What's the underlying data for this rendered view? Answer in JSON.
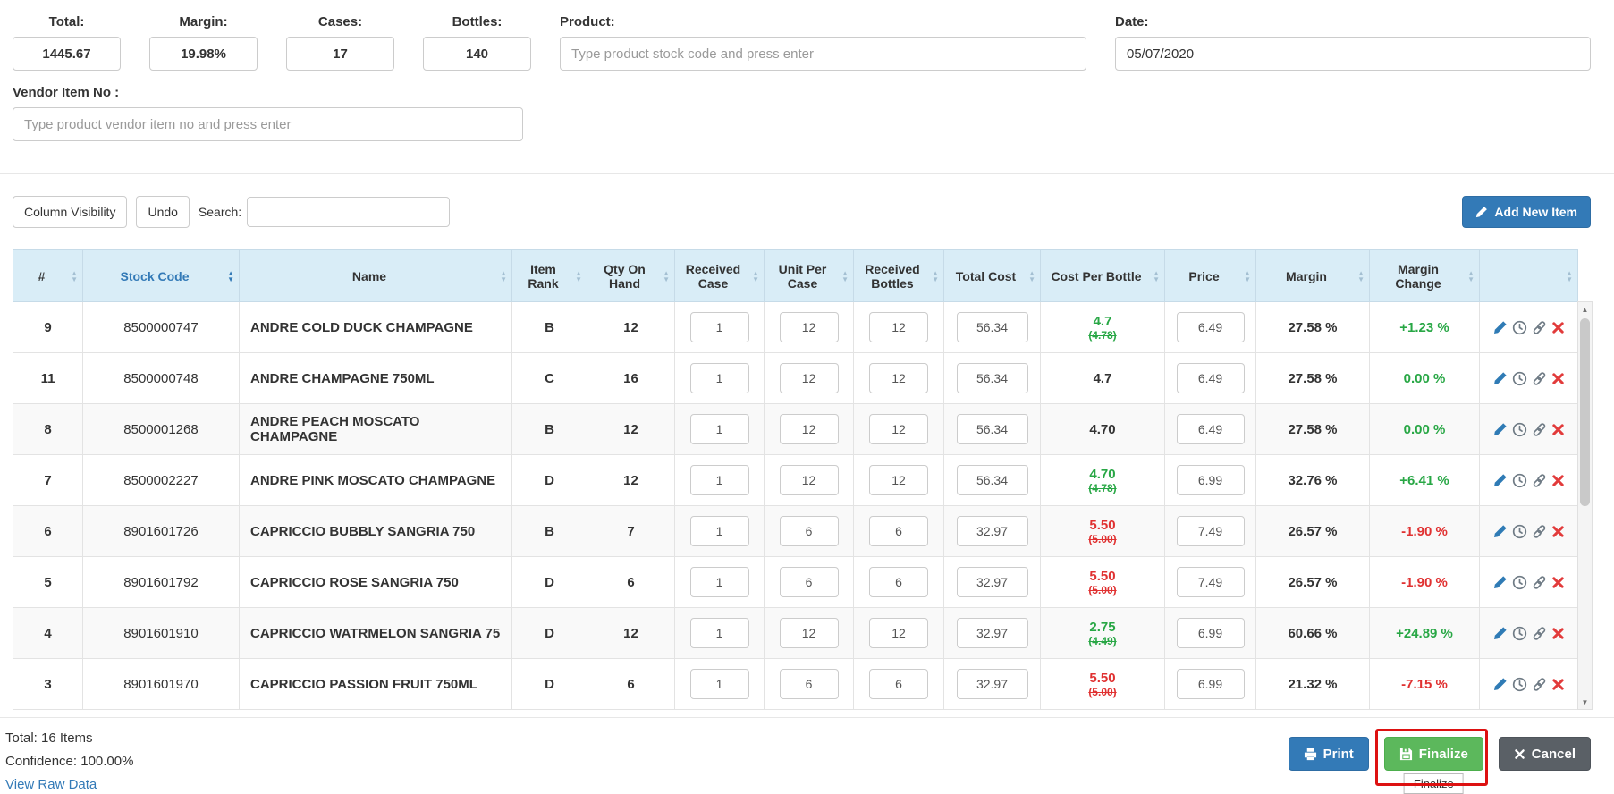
{
  "header": {
    "stats": [
      {
        "label": "Total:",
        "value": "1445.67"
      },
      {
        "label": "Margin:",
        "value": "19.98%"
      },
      {
        "label": "Cases:",
        "value": "17"
      },
      {
        "label": "Bottles:",
        "value": "140"
      }
    ],
    "product_label": "Product:",
    "product_placeholder": "Type product stock code and press enter",
    "date_label": "Date:",
    "date_value": "05/07/2020",
    "vendor_label": "Vendor Item No :",
    "vendor_placeholder": "Type product vendor item no and press enter"
  },
  "toolbar": {
    "column_visibility": "Column Visibility",
    "undo": "Undo",
    "search_label": "Search:",
    "search_value": "",
    "add_new_item": "Add New Item"
  },
  "table": {
    "columns": [
      "#",
      "Stock Code",
      "Name",
      "Item Rank",
      "Qty On Hand",
      "Received Case",
      "Unit Per Case",
      "Received Bottles",
      "Total Cost",
      "Cost Per Bottle",
      "Price",
      "Margin",
      "Margin Change",
      ""
    ],
    "sorted_column": "Stock Code",
    "rows": [
      {
        "num": "9",
        "stock": "8500000747",
        "name": "ANDRE COLD DUCK CHAMPAGNE",
        "rank": "B",
        "qty": "12",
        "received_case": "1",
        "unit_per_case": "12",
        "received_bottles": "12",
        "total_cost": "56.34",
        "cost_per_bottle": "4.7",
        "cost_old": "(4.78)",
        "cost_color": "green",
        "price": "6.49",
        "margin": "27.58 %",
        "margin_change": "+1.23 %",
        "change_color": "green"
      },
      {
        "num": "11",
        "stock": "8500000748",
        "name": "ANDRE CHAMPAGNE 750ML",
        "rank": "C",
        "qty": "16",
        "received_case": "1",
        "unit_per_case": "12",
        "received_bottles": "12",
        "total_cost": "56.34",
        "cost_per_bottle": "4.7",
        "cost_old": "",
        "cost_color": "dark",
        "price": "6.49",
        "margin": "27.58 %",
        "margin_change": "0.00 %",
        "change_color": "green"
      },
      {
        "num": "8",
        "stock": "8500001268",
        "name": "ANDRE PEACH MOSCATO\nCHAMPAGNE",
        "rank": "B",
        "qty": "12",
        "received_case": "1",
        "unit_per_case": "12",
        "received_bottles": "12",
        "total_cost": "56.34",
        "cost_per_bottle": "4.70",
        "cost_old": "",
        "cost_color": "dark",
        "price": "6.49",
        "margin": "27.58 %",
        "margin_change": "0.00 %",
        "change_color": "green"
      },
      {
        "num": "7",
        "stock": "8500002227",
        "name": "ANDRE PINK MOSCATO CHAMPAGNE",
        "rank": "D",
        "qty": "12",
        "received_case": "1",
        "unit_per_case": "12",
        "received_bottles": "12",
        "total_cost": "56.34",
        "cost_per_bottle": "4.70",
        "cost_old": "(4.78)",
        "cost_color": "green",
        "price": "6.99",
        "margin": "32.76 %",
        "margin_change": "+6.41 %",
        "change_color": "green"
      },
      {
        "num": "6",
        "stock": "8901601726",
        "name": "CAPRICCIO BUBBLY SANGRIA 750",
        "rank": "B",
        "qty": "7",
        "received_case": "1",
        "unit_per_case": "6",
        "received_bottles": "6",
        "total_cost": "32.97",
        "cost_per_bottle": "5.50",
        "cost_old": "(5.00)",
        "cost_color": "red",
        "price": "7.49",
        "margin": "26.57 %",
        "margin_change": "-1.90 %",
        "change_color": "red"
      },
      {
        "num": "5",
        "stock": "8901601792",
        "name": "CAPRICCIO ROSE SANGRIA 750",
        "rank": "D",
        "qty": "6",
        "received_case": "1",
        "unit_per_case": "6",
        "received_bottles": "6",
        "total_cost": "32.97",
        "cost_per_bottle": "5.50",
        "cost_old": "(5.00)",
        "cost_color": "red",
        "price": "7.49",
        "margin": "26.57 %",
        "margin_change": "-1.90 %",
        "change_color": "red"
      },
      {
        "num": "4",
        "stock": "8901601910",
        "name": "CAPRICCIO WATRMELON SANGRIA 75",
        "rank": "D",
        "qty": "12",
        "received_case": "1",
        "unit_per_case": "12",
        "received_bottles": "12",
        "total_cost": "32.97",
        "cost_per_bottle": "2.75",
        "cost_old": "(4.49)",
        "cost_color": "green",
        "price": "6.99",
        "margin": "60.66 %",
        "margin_change": "+24.89 %",
        "change_color": "green"
      },
      {
        "num": "3",
        "stock": "8901601970",
        "name": "CAPRICCIO PASSION FRUIT 750ML",
        "rank": "D",
        "qty": "6",
        "received_case": "1",
        "unit_per_case": "6",
        "received_bottles": "6",
        "total_cost": "32.97",
        "cost_per_bottle": "5.50",
        "cost_old": "(5.00)",
        "cost_color": "red",
        "price": "6.99",
        "margin": "21.32 %",
        "margin_change": "-7.15 %",
        "change_color": "red"
      }
    ]
  },
  "footer": {
    "total_items": "Total: 16 Items",
    "confidence": "Confidence: 100.00%",
    "view_raw_data": "View Raw Data",
    "print": "Print",
    "finalize": "Finalize",
    "finalize_tooltip": "Finalize",
    "cancel": "Cancel"
  },
  "icons": {
    "sort_up": "▲",
    "sort_down": "▼",
    "scroll_up": "▲",
    "scroll_down": "▼"
  },
  "colors": {
    "accent_blue": "#337ab7",
    "success_green": "#5cb85c",
    "danger_red": "#e03131",
    "table_header_bg": "#d9edf7",
    "annotation_red": "#dd1111"
  }
}
